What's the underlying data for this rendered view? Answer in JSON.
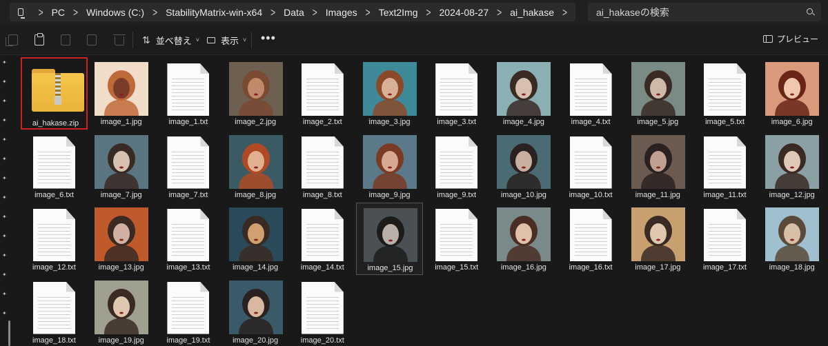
{
  "address": {
    "crumbs": [
      "PC",
      "Windows (C:)",
      "StabilityMatrix-win-x64",
      "Data",
      "Images",
      "Text2Img",
      "2024-08-27",
      "ai_hakase"
    ],
    "search_placeholder": "ai_hakaseの検索"
  },
  "toolbar": {
    "sort_label": "並べ替え",
    "view_label": "表示",
    "more_label": "•••",
    "preview_label": "プレビュー"
  },
  "files": [
    {
      "name": "ai_hakase.zip",
      "kind": "zip",
      "selected": true
    },
    {
      "name": "image_1.jpg",
      "kind": "image",
      "palette": [
        "#f0dcc8",
        "#c06a3a",
        "#7a3c2a"
      ]
    },
    {
      "name": "image_1.txt",
      "kind": "text"
    },
    {
      "name": "image_2.jpg",
      "kind": "image",
      "palette": [
        "#6d6050",
        "#7a4a32",
        "#c08a6a"
      ]
    },
    {
      "name": "image_2.txt",
      "kind": "text"
    },
    {
      "name": "image_3.jpg",
      "kind": "image",
      "palette": [
        "#3f8a9a",
        "#8a4a2a",
        "#d8b098"
      ]
    },
    {
      "name": "image_3.txt",
      "kind": "text"
    },
    {
      "name": "image_4.jpg",
      "kind": "image",
      "palette": [
        "#8ab0b4",
        "#3a2a24",
        "#d8c0b0"
      ]
    },
    {
      "name": "image_4.txt",
      "kind": "text"
    },
    {
      "name": "image_5.jpg",
      "kind": "image",
      "palette": [
        "#7a8a84",
        "#3a2a24",
        "#d0b8a8"
      ]
    },
    {
      "name": "image_5.txt",
      "kind": "text"
    },
    {
      "name": "image_6.jpg",
      "kind": "image",
      "palette": [
        "#d89a7a",
        "#6a2418",
        "#f0c8b0"
      ]
    },
    {
      "name": "image_6.txt",
      "kind": "text"
    },
    {
      "name": "image_7.jpg",
      "kind": "image",
      "palette": [
        "#5a7480",
        "#3a2a24",
        "#d8c0b0"
      ]
    },
    {
      "name": "image_7.txt",
      "kind": "text"
    },
    {
      "name": "image_8.jpg",
      "kind": "image",
      "palette": [
        "#3a5a64",
        "#b04a24",
        "#e0b090"
      ]
    },
    {
      "name": "image_8.txt",
      "kind": "text"
    },
    {
      "name": "image_9.jpg",
      "kind": "image",
      "palette": [
        "#5a7a8a",
        "#7a3a24",
        "#d8a890"
      ]
    },
    {
      "name": "image_9.txt",
      "kind": "text"
    },
    {
      "name": "image_10.jpg",
      "kind": "image",
      "palette": [
        "#4a6a74",
        "#2a2220",
        "#c8b0a0"
      ]
    },
    {
      "name": "image_10.txt",
      "kind": "text"
    },
    {
      "name": "image_11.jpg",
      "kind": "image",
      "palette": [
        "#6a5a50",
        "#2a2220",
        "#c0a090"
      ]
    },
    {
      "name": "image_11.txt",
      "kind": "text"
    },
    {
      "name": "image_12.jpg",
      "kind": "image",
      "palette": [
        "#8aa0a4",
        "#3a2a24",
        "#e0c8b8"
      ]
    },
    {
      "name": "image_12.txt",
      "kind": "text"
    },
    {
      "name": "image_13.jpg",
      "kind": "image",
      "palette": [
        "#c05a2a",
        "#3a2a24",
        "#d0b0a0"
      ]
    },
    {
      "name": "image_13.txt",
      "kind": "text"
    },
    {
      "name": "image_14.jpg",
      "kind": "image",
      "palette": [
        "#2a4a5a",
        "#3a2a24",
        "#d0a070"
      ]
    },
    {
      "name": "image_14.txt",
      "kind": "text"
    },
    {
      "name": "image_15.jpg",
      "kind": "image",
      "palette": [
        "#4a5054",
        "#1c1c1c",
        "#b8b0a8"
      ],
      "hovered": true
    },
    {
      "name": "image_15.txt",
      "kind": "text"
    },
    {
      "name": "image_16.jpg",
      "kind": "image",
      "palette": [
        "#7a8a8a",
        "#4a2e24",
        "#e0c0a8"
      ]
    },
    {
      "name": "image_16.txt",
      "kind": "text"
    },
    {
      "name": "image_17.jpg",
      "kind": "image",
      "palette": [
        "#c8a070",
        "#3a2a24",
        "#e0c8b0"
      ]
    },
    {
      "name": "image_17.txt",
      "kind": "text"
    },
    {
      "name": "image_18.jpg",
      "kind": "image",
      "palette": [
        "#a0c0d0",
        "#5a4a3a",
        "#d8c0a8"
      ]
    },
    {
      "name": "image_18.txt",
      "kind": "text"
    },
    {
      "name": "image_19.jpg",
      "kind": "image",
      "palette": [
        "#a0a090",
        "#3a2a24",
        "#e0c8b0"
      ]
    },
    {
      "name": "image_19.txt",
      "kind": "text"
    },
    {
      "name": "image_20.jpg",
      "kind": "image",
      "palette": [
        "#3a5a6a",
        "#2a2220",
        "#d8b8a0"
      ]
    },
    {
      "name": "image_20.txt",
      "kind": "text"
    }
  ]
}
